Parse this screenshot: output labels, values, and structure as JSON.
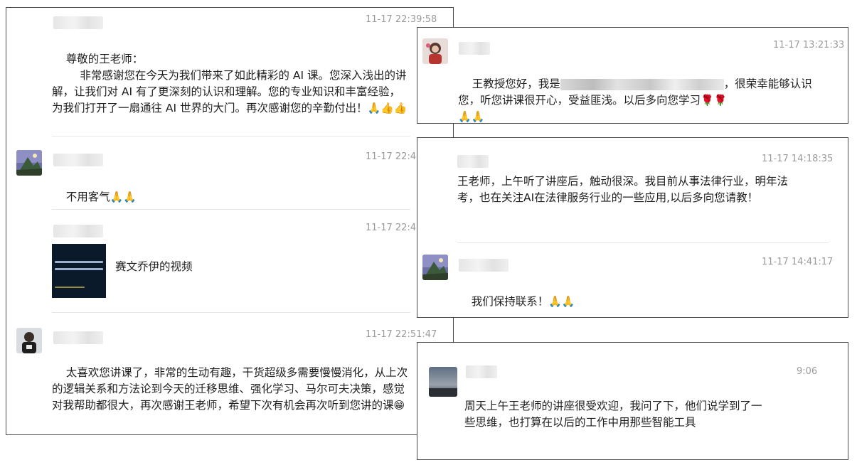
{
  "panel1": {
    "m1": {
      "time": "11-17 22:39:58",
      "text": "尊敬的王老师：\n        非常感谢您在今天为我们带来了如此精彩的 AI 课。您深入浅出的讲解，让我们对 AI 有了更深刻的认识和理解。您的专业知识和丰富经验，为我们打开了一扇通往 AI 世界的大门。再次感谢您的辛勤付出！",
      "emoji": "🙏👍👍"
    },
    "m2": {
      "time": "11-17 22:4",
      "text": "不用客气",
      "emoji": "🙏🙏"
    },
    "m3": {
      "time": "11-17 22:4",
      "video_title": "赛文乔伊的视频"
    },
    "m4": {
      "time": "11-17 22:51:47",
      "text": "太喜欢您讲课了，非常的生动有趣，干货超级多需要慢慢消化，从上次的逻辑关系和方法论到今天的迁移思维、强化学习、马尔可夫决策，感觉对我帮助都很大，再次感谢王老师，希望下次有机会再次听到您讲的课",
      "emoji": "😁"
    }
  },
  "panel2": {
    "m1": {
      "time": "11-17 13:21:33",
      "text_a": "王教授您好，我是",
      "text_b": "，很荣幸能够认识您，听您讲课很开心，受益匪浅。以后多向您学习",
      "emoji_a": "🌹🌹",
      "emoji_b": "🙏🙏"
    }
  },
  "panel3": {
    "m1": {
      "time": "11-17 14:18:35",
      "text": "王老师，上午听了讲座后，触动很深。我目前从事法律行业，明年法考，也在关注AI在法律服务行业的一些应用,以后多向您请教！"
    },
    "m2": {
      "time": "11-17 14:41:17",
      "text": "我们保持联系！",
      "emoji": "🙏🙏"
    }
  },
  "panel4": {
    "m1": {
      "time": "9:06",
      "text": "周天上午王老师的讲座很受欢迎，我问了下，他们说学到了一些思维，也打算在以后的工作中用那些智能工具"
    }
  }
}
